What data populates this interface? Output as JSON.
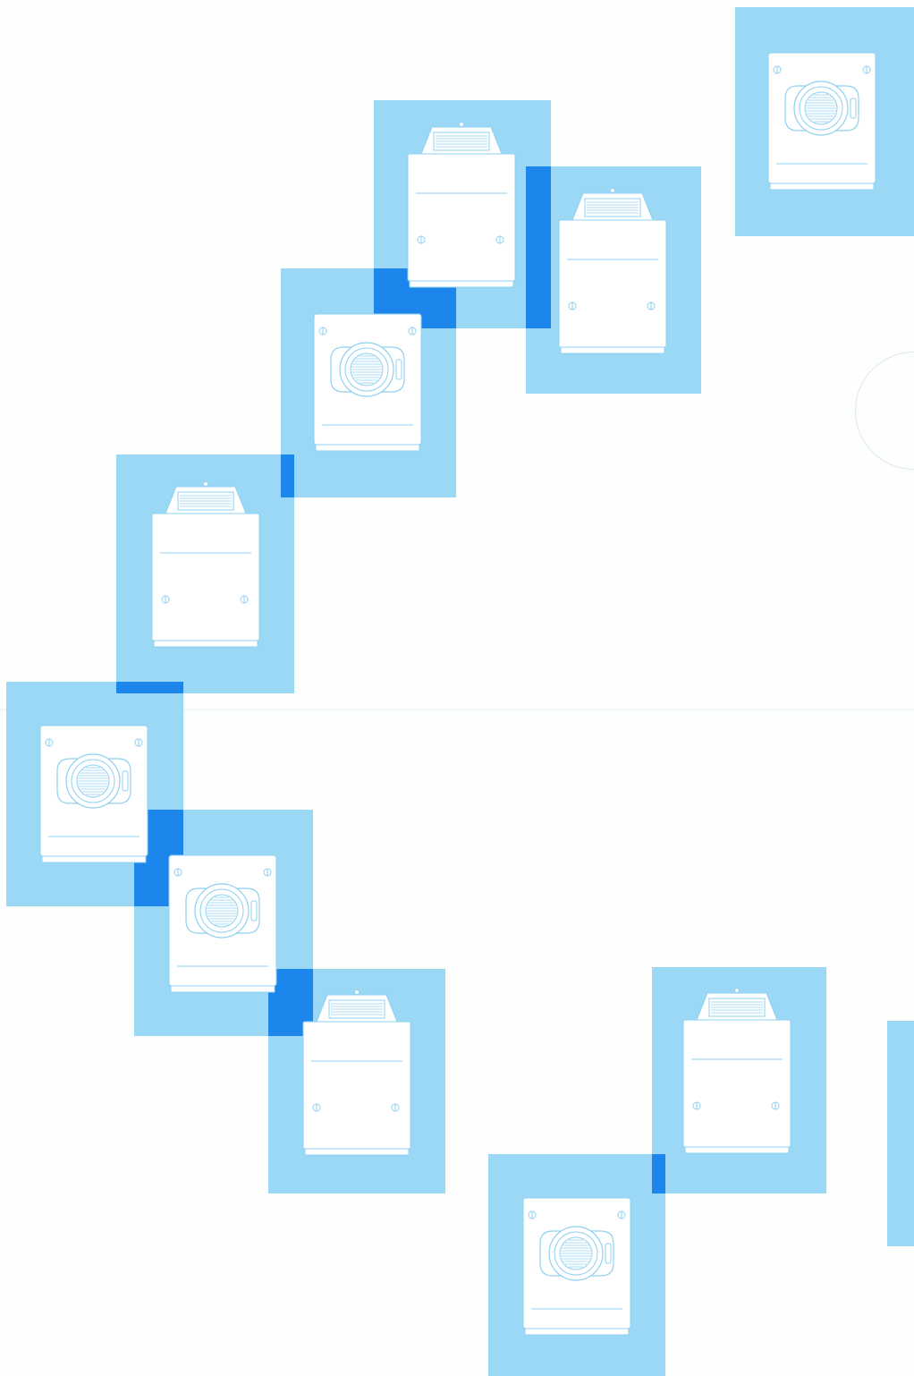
{
  "colors": {
    "background": "#fdfefe",
    "tile": "#9bd8f6",
    "overlap": "#1c86ec",
    "machine_body": "#ffffff",
    "machine_line": "#8fd0f0"
  },
  "icons": {
    "front_loader": "front-loading-washer-icon",
    "top_loader": "top-loading-washer-icon"
  },
  "tiles": [
    {
      "id": "tile-1",
      "machine": "front-loader"
    },
    {
      "id": "tile-2",
      "machine": "top-loader"
    },
    {
      "id": "tile-3",
      "machine": "top-loader"
    },
    {
      "id": "tile-4",
      "machine": "front-loader"
    },
    {
      "id": "tile-5",
      "machine": "top-loader"
    },
    {
      "id": "tile-6",
      "machine": "front-loader"
    },
    {
      "id": "tile-7",
      "machine": "front-loader"
    },
    {
      "id": "tile-8",
      "machine": "top-loader"
    },
    {
      "id": "tile-9",
      "machine": "top-loader"
    },
    {
      "id": "tile-10",
      "machine": "front-loader"
    },
    {
      "id": "tile-11",
      "machine": "none"
    }
  ]
}
